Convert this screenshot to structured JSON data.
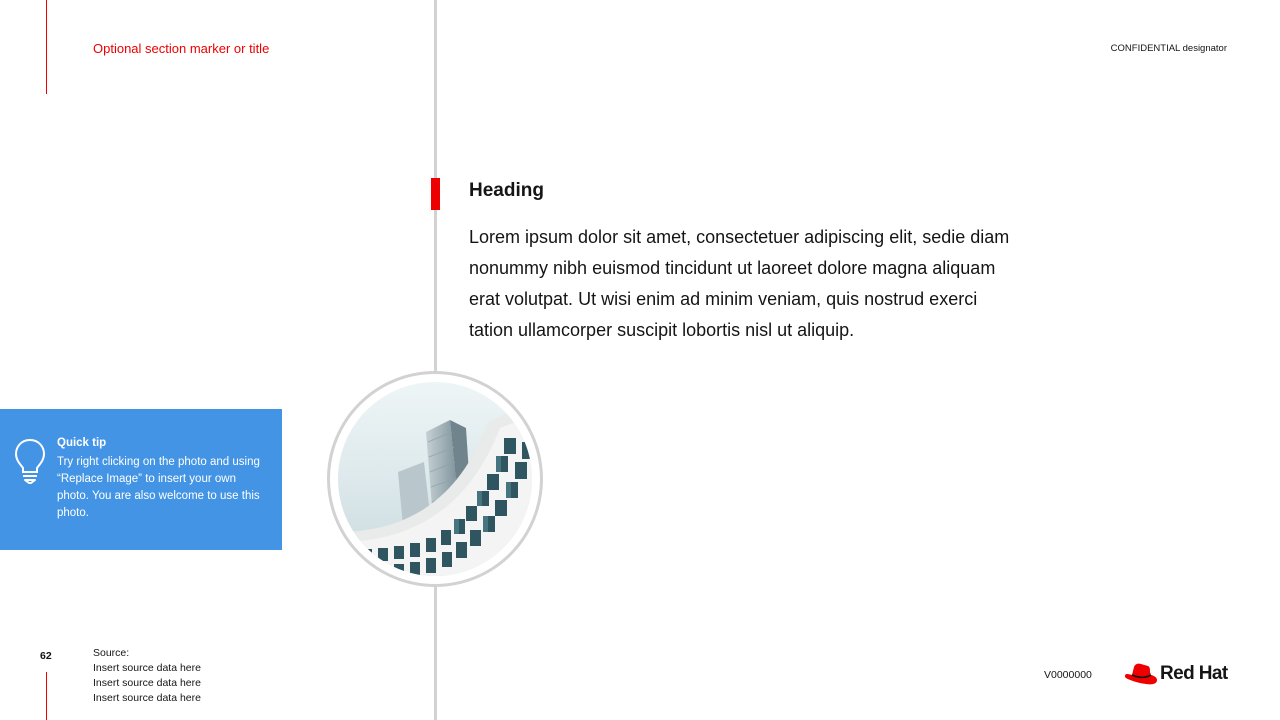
{
  "header": {
    "section_marker": "Optional section marker or title",
    "confidential": "CONFIDENTIAL designator"
  },
  "content": {
    "heading": "Heading",
    "body": "Lorem ipsum dolor sit amet, consectetuer adipiscing elit, sedie diam nonummy nibh euismod tincidunt ut laoreet dolore magna aliquam erat volutpat. Ut wisi enim ad minim veniam, quis nostrud exerci tation ullamcorper suscipit lobortis nisl ut aliquip."
  },
  "tip": {
    "title": "Quick tip",
    "body": "Try right clicking on the photo and using “Replace Image” to insert your own photo. You are also welcome to use this photo.",
    "icon": "lightbulb-icon"
  },
  "footer": {
    "page_number": "62",
    "source_label": "Source:",
    "source_lines": [
      "Insert source data here",
      "Insert source data here",
      "Insert source data here"
    ],
    "version": "V0000000",
    "logo_text": "Red Hat"
  },
  "colors": {
    "brand_red": "#ee0000",
    "tip_blue": "#4394e5",
    "rule_gray": "#d2d2d2",
    "text": "#151515"
  }
}
